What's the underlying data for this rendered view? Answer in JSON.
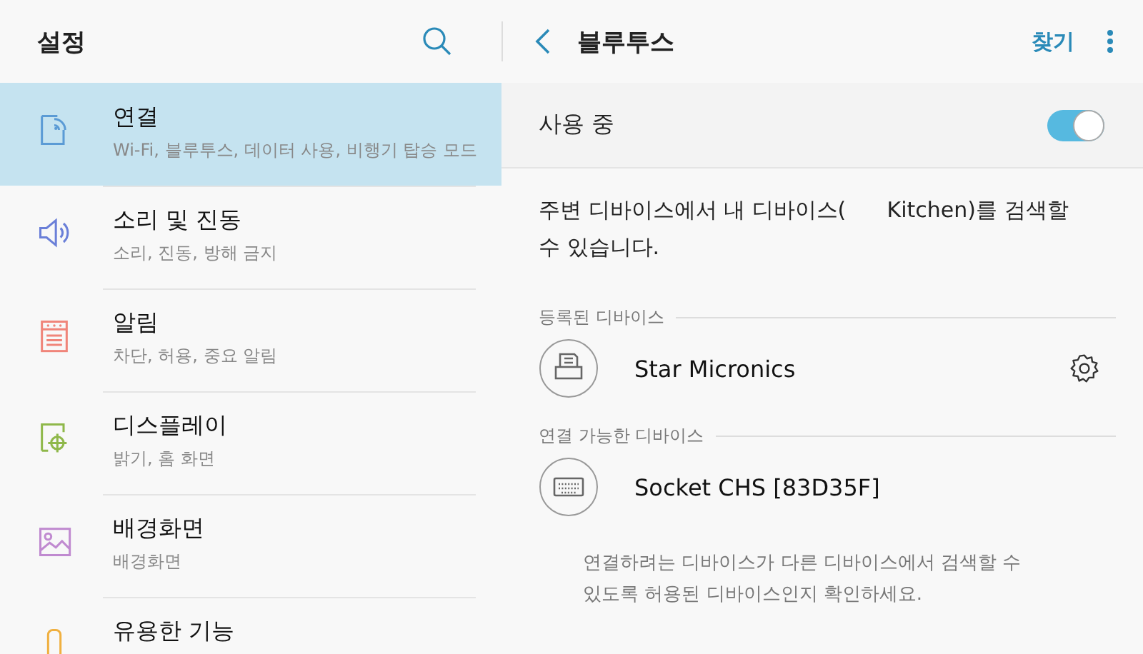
{
  "sidebar": {
    "title": "설정",
    "items": [
      {
        "title": "연결",
        "subtitle": "Wi-Fi, 블루투스, 데이터 사용, 비행기 탑승 모드",
        "kind": "connections",
        "color": "#5b9bd5",
        "selected": true
      },
      {
        "title": "소리 및 진동",
        "subtitle": "소리, 진동, 방해 금지",
        "kind": "sound",
        "color": "#6a7fd8",
        "selected": false
      },
      {
        "title": "알림",
        "subtitle": "차단, 허용, 중요 알림",
        "kind": "notifications",
        "color": "#f0857a",
        "selected": false
      },
      {
        "title": "디스플레이",
        "subtitle": "밝기, 홈 화면",
        "kind": "display",
        "color": "#8fb84a",
        "selected": false
      },
      {
        "title": "배경화면",
        "subtitle": "배경화면",
        "kind": "wallpaper",
        "color": "#c08ad0",
        "selected": false
      },
      {
        "title": "유용한 기능",
        "kind": "advanced",
        "color": "#f0b040",
        "selected": false
      }
    ]
  },
  "detail": {
    "title": "블루투스",
    "action": "찾기",
    "toggle": {
      "label": "사용 중",
      "on": true
    },
    "description": "주변 디바이스에서 내 디바이스(      Kitchen)를 검색할 수 있습니다.",
    "sections": [
      {
        "title": "등록된 디바이스",
        "devices": [
          {
            "name": "Star Micronics",
            "kind": "printer",
            "settings": true
          }
        ]
      },
      {
        "title": "연결 가능한 디바이스",
        "devices": [
          {
            "name": "Socket CHS [83D35F]",
            "kind": "keyboard",
            "settings": false
          }
        ]
      }
    ],
    "note": "연결하려는 디바이스가 다른 디바이스에서 검색할 수 있도록 허용된 디바이스인지 확인하세요."
  }
}
